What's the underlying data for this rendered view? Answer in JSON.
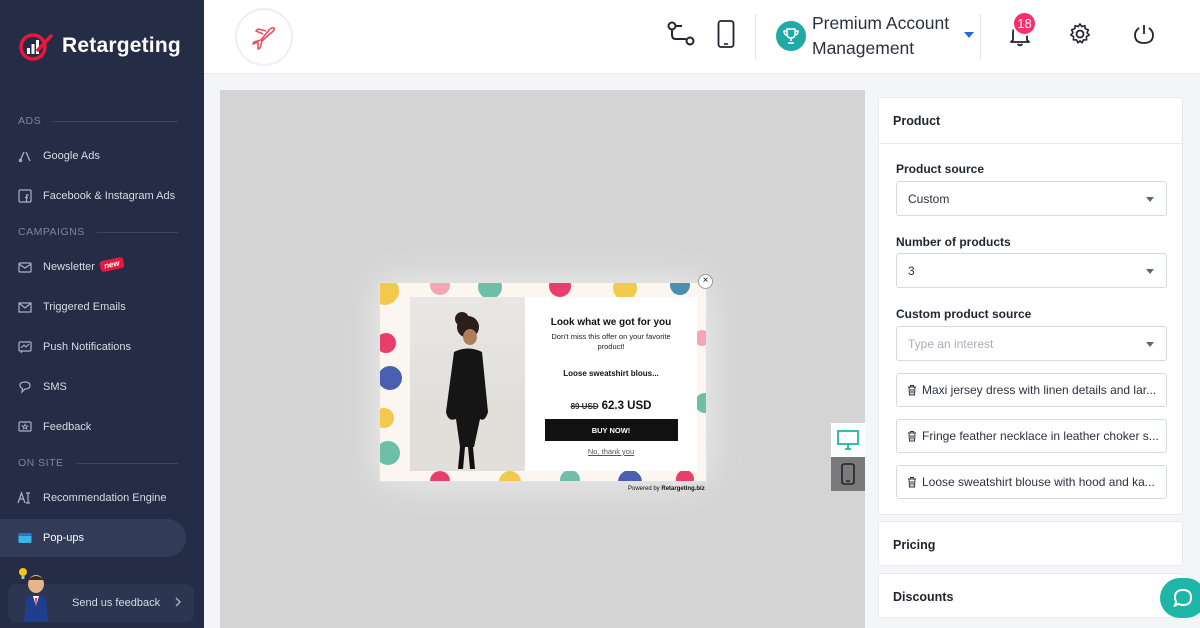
{
  "brand": {
    "name": "Retargeting"
  },
  "sidebar": {
    "sections": {
      "ads": "ADS",
      "campaigns": "CAMPAIGNS",
      "on_site": "ON SITE"
    },
    "items": [
      {
        "label": "Google Ads",
        "icon": "google-ads-icon"
      },
      {
        "label": "Facebook & Instagram Ads",
        "icon": "facebook-icon"
      },
      {
        "label": "Newsletter",
        "icon": "newsletter-icon",
        "badge": "new"
      },
      {
        "label": "Triggered Emails",
        "icon": "email-icon"
      },
      {
        "label": "Push Notifications",
        "icon": "push-icon"
      },
      {
        "label": "SMS",
        "icon": "sms-icon"
      },
      {
        "label": "Feedback",
        "icon": "feedback-icon"
      },
      {
        "label": "Recommendation Engine",
        "icon": "ai-icon"
      },
      {
        "label": "Pop-ups",
        "icon": "popup-icon",
        "active": true
      }
    ],
    "feedback": {
      "label": "Send us feedback"
    }
  },
  "topbar": {
    "account": "Premium Account Management",
    "notifications": "18"
  },
  "popup": {
    "title": "Look what we got for you",
    "subtitle": "Don't miss this offer on your favorite product!",
    "product": "Loose sweatshirt blous...",
    "old_price": "89 USD",
    "new_price": "62.3 USD",
    "button": "BUY NOW!",
    "decline": "No, thank you",
    "close": "×",
    "powered_prefix": "Powered by ",
    "powered_brand": "Retargeting.biz"
  },
  "panel": {
    "product_title": "Product",
    "source_label": "Product source",
    "source_value": "Custom",
    "number_label": "Number of products",
    "number_value": "3",
    "custom_label": "Custom product source",
    "custom_placeholder": "Type an interest",
    "chips": [
      "Maxi jersey dress with linen details and lar...",
      "Fringe feather necklace in leather choker s...",
      "Loose sweatshirt blouse with hood and ka..."
    ],
    "pricing_title": "Pricing",
    "discounts_title": "Discounts"
  },
  "colors": {
    "sidebar": "#242d45",
    "accent_red": "#e8173e",
    "teal": "#1faaa6",
    "badge_pink": "#ff2d6d"
  }
}
